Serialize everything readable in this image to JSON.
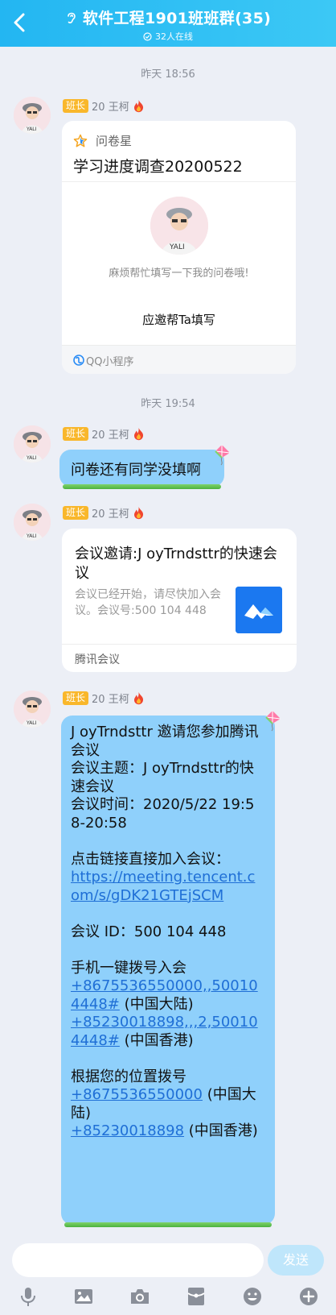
{
  "header": {
    "title": "软件工程1901班班群(35)",
    "online": "32人在线",
    "bg": "#23b6f2"
  },
  "timestamps": [
    "昨天 18:56",
    "昨天 19:54"
  ],
  "sender": {
    "badge": "班长",
    "name": "20 王柯"
  },
  "survey_card": {
    "app_name": "问卷星",
    "title": "学习进度调查20200522",
    "subtitle": "麻烦帮忙填写一下我的问卷哦!",
    "action": "应邀帮Ta填写",
    "footer": "QQ小程序"
  },
  "msg_text": "问卷还有同学没填啊",
  "meeting_card": {
    "title": "会议邀请:J oyTrndsttr的快速会议",
    "desc": "会议已经开始，请尽快加入会议。会议号:500 104 448",
    "footer": "腾讯会议"
  },
  "long_msg": {
    "l1": "J oyTrndsttr 邀请您参加腾讯会议",
    "l2": "会议主题：J oyTrndsttr的快速会议",
    "l3": "会议时间：2020/5/22 19:58-20:58",
    "l4": "点击链接直接加入会议：",
    "link": "https://meeting.tencent.com/s/gDK21GTEjSCM",
    "l5": "会议 ID：500 104 448",
    "l6": "手机一键拨号入会",
    "phone1": "+8675536550000,,500104448#",
    "phone1_suffix": " (中国大陆)",
    "phone2": "+85230018898,,,2,500104448#",
    "phone2_suffix": " (中国香港)",
    "l7": "根据您的位置拨号",
    "phone3": "+8675536550000",
    "phone3_suffix": " (中国大陆)",
    "phone4": "+85230018898",
    "phone4_suffix": " (中国香港)"
  },
  "input": {
    "placeholder": "",
    "send_label": "发送"
  },
  "toolbar": [
    "microphone-icon",
    "image-icon",
    "camera-icon",
    "red-packet-icon",
    "emoji-icon",
    "plus-icon"
  ],
  "colors": {
    "bubble": "#8fd0fb",
    "badge": "#f9b72b",
    "link": "#1f6fd6",
    "meeting_logo": "#1b78f0"
  }
}
